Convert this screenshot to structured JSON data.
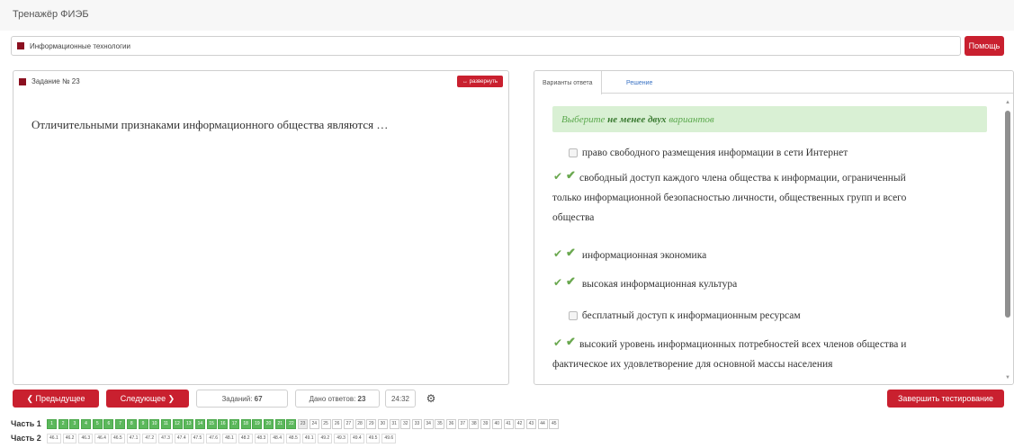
{
  "app": {
    "title": "Тренажёр ФИЭБ"
  },
  "subject": {
    "name": "Информационные технологии",
    "help_label": "Помощь"
  },
  "task": {
    "number_label": "Задание № 23",
    "expand_label": "↔ развернуть",
    "question": "Отличительными признаками информационного общества являются …"
  },
  "answers": {
    "tabs": [
      {
        "label": "Варианты ответа"
      },
      {
        "label": "Решение"
      }
    ],
    "hint_prefix": "Выберите",
    "hint_bold": "не менее двух",
    "hint_suffix": "вариантов",
    "options": [
      {
        "line1": "право свободного размещения информации в сети Интернет",
        "line2": "",
        "line3": "",
        "checked": false
      },
      {
        "line1": "свободный доступ каждого члена общества к информации, ограниченный",
        "line2": "только информационной безопасностью личности, общественных групп и всего",
        "line3": "общества",
        "checked": true
      },
      {
        "line1": "информационная экономика",
        "line2": "",
        "line3": "",
        "checked": true
      },
      {
        "line1": "высокая информационная культура",
        "line2": "",
        "line3": "",
        "checked": true
      },
      {
        "line1": "бесплатный доступ к информационным ресурсам",
        "line2": "",
        "line3": "",
        "checked": false
      },
      {
        "line1": "высокий уровень информационных потребностей всех членов общества и",
        "line2": "фактическое их удовлетворение для основной массы населения",
        "line3": "",
        "checked": true
      }
    ]
  },
  "footer": {
    "prev_label": "❮ Предыдущее",
    "next_label": "Следующее ❯",
    "tasks_label": "Заданий:",
    "tasks_count": "67",
    "answers_label": "Дано ответов:",
    "answers_count": "23",
    "timer": "24:32",
    "finish_label": "Завершить тестирование"
  },
  "parts": [
    {
      "label": "Часть 1",
      "items": [
        "1",
        "2",
        "3",
        "4",
        "5",
        "6",
        "7",
        "8",
        "9",
        "10",
        "11",
        "12",
        "13",
        "14",
        "15",
        "16",
        "17",
        "18",
        "19",
        "20",
        "21",
        "22",
        "23",
        "24",
        "25",
        "26",
        "27",
        "28",
        "29",
        "30",
        "31",
        "32",
        "33",
        "34",
        "35",
        "36",
        "37",
        "38",
        "39",
        "40",
        "41",
        "42",
        "43",
        "44",
        "45"
      ],
      "done_count": 22,
      "current_index": 22
    },
    {
      "label": "Часть 2",
      "items": [
        "46.1",
        "46.2",
        "46.3",
        "46.4",
        "46.5",
        "47.1",
        "47.2",
        "47.3",
        "47.4",
        "47.5",
        "47.6",
        "48.1",
        "48.2",
        "48.3",
        "48.4",
        "48.5",
        "49.1",
        "49.2",
        "49.3",
        "49.4",
        "49.5",
        "49.6"
      ]
    }
  ],
  "colors": {
    "accent_red": "#c9202f",
    "done_green": "#5cb85c",
    "hint_bg": "#d9f0d4"
  }
}
